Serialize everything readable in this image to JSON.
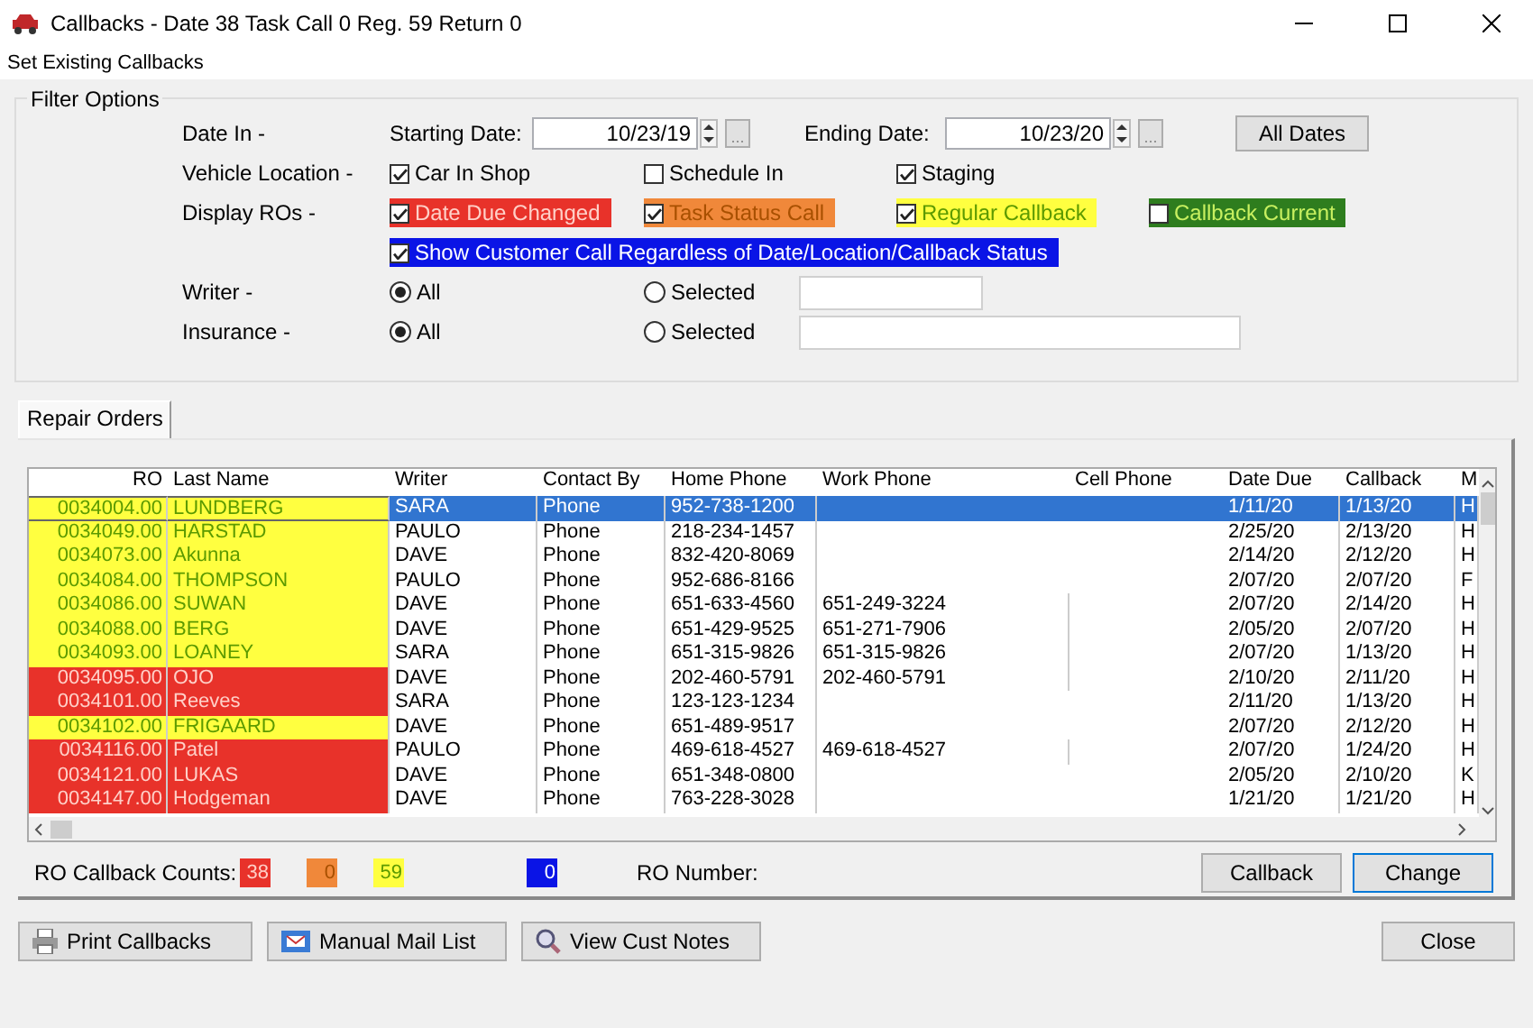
{
  "window": {
    "title": "Callbacks - Date 38 Task Call 0 Reg. 59 Return 0"
  },
  "menu": [
    "Set Existing Callbacks"
  ],
  "filter_options": {
    "title": "Filter Options",
    "date_in": {
      "label": "Date In -",
      "starting_label": "Starting Date:",
      "starting_value": "10/23/19",
      "ending_label": "Ending Date:",
      "ending_value": "10/23/20",
      "browse_button": "...",
      "all_dates_button": "All Dates"
    },
    "vehicle_location": {
      "label": "Vehicle Location -",
      "options": [
        {
          "label": "Car In Shop",
          "checked": true
        },
        {
          "label": "Schedule In",
          "checked": false
        },
        {
          "label": "Staging",
          "checked": true
        }
      ]
    },
    "display_ros": {
      "label": "Display ROs -",
      "options": [
        {
          "label": "Date Due Changed",
          "checked": true,
          "kind": "date_due",
          "color": "#e8322a"
        },
        {
          "label": "Task Status Call",
          "checked": true,
          "kind": "task",
          "color": "#f0883a"
        },
        {
          "label": "Regular Callback",
          "checked": true,
          "kind": "regular",
          "color": "#ffff40"
        },
        {
          "label": "Callback Current",
          "checked": false,
          "kind": "current",
          "color": "#2e7d1e"
        }
      ],
      "show_customer_call": {
        "label": "Show Customer Call Regardless of Date/Location/Callback Status",
        "checked": true,
        "kind": "show_all",
        "color": "#0a14e6"
      }
    },
    "writer": {
      "label": "Writer -",
      "options": [
        {
          "label": "All",
          "selected": true
        },
        {
          "label": "Selected",
          "selected": false
        }
      ]
    },
    "insurance": {
      "label": "Insurance -",
      "options": [
        {
          "label": "All",
          "selected": true
        },
        {
          "label": "Selected",
          "selected": false
        }
      ]
    }
  },
  "tabs": [
    {
      "label": "Repair Orders",
      "selected": true
    }
  ],
  "table": {
    "columns": [
      "RO",
      "Last Name",
      "Writer",
      "Contact By",
      "Home Phone",
      "Work Phone",
      "Cell Phone",
      "Date Due",
      "Callback",
      "M"
    ],
    "rows": [
      {
        "kind": "regular",
        "color": "#ffff40",
        "selected": true,
        "cells": [
          "0034004.00",
          "LUNDBERG",
          "SARA",
          "Phone",
          "952-738-1200",
          "",
          "",
          "1/11/20",
          "1/13/20",
          "H"
        ]
      },
      {
        "kind": "regular",
        "color": "#ffff40",
        "selected": false,
        "cells": [
          "0034049.00",
          "HARSTAD",
          "PAULO",
          "Phone",
          "218-234-1457",
          "",
          "",
          "2/25/20",
          "2/13/20",
          "H"
        ]
      },
      {
        "kind": "regular",
        "color": "#ffff40",
        "selected": false,
        "cells": [
          "0034073.00",
          "Akunna",
          "DAVE",
          "Phone",
          "832-420-8069",
          "",
          "",
          "2/14/20",
          "2/12/20",
          "H"
        ]
      },
      {
        "kind": "regular",
        "color": "#ffff40",
        "selected": false,
        "cells": [
          "0034084.00",
          "THOMPSON",
          "PAULO",
          "Phone",
          "952-686-8166",
          "",
          "",
          "2/07/20",
          "2/07/20",
          "F"
        ]
      },
      {
        "kind": "regular",
        "color": "#ffff40",
        "selected": false,
        "cells": [
          "0034086.00",
          "SUWAN",
          "DAVE",
          "Phone",
          "651-633-4560",
          "651-249-3224",
          "",
          "2/07/20",
          "2/14/20",
          "H"
        ]
      },
      {
        "kind": "regular",
        "color": "#ffff40",
        "selected": false,
        "cells": [
          "0034088.00",
          "BERG",
          "DAVE",
          "Phone",
          "651-429-9525",
          "651-271-7906",
          "",
          "2/05/20",
          "2/07/20",
          "H"
        ]
      },
      {
        "kind": "regular",
        "color": "#ffff40",
        "selected": false,
        "cells": [
          "0034093.00",
          "LOANEY",
          "SARA",
          "Phone",
          "651-315-9826",
          "651-315-9826",
          "",
          "2/07/20",
          "1/13/20",
          "H"
        ]
      },
      {
        "kind": "date_due",
        "color": "#e8322a",
        "selected": false,
        "cells": [
          "0034095.00",
          "OJO",
          "DAVE",
          "Phone",
          "202-460-5791",
          "202-460-5791",
          "",
          "2/10/20",
          "2/11/20",
          "H"
        ]
      },
      {
        "kind": "date_due",
        "color": "#e8322a",
        "selected": false,
        "cells": [
          "0034101.00",
          "Reeves",
          "SARA",
          "Phone",
          "123-123-1234",
          "",
          "",
          "2/11/20",
          "1/13/20",
          "H"
        ]
      },
      {
        "kind": "regular",
        "color": "#ffff40",
        "selected": false,
        "cells": [
          "0034102.00",
          "FRIGAARD",
          "DAVE",
          "Phone",
          "651-489-9517",
          "",
          "",
          "2/07/20",
          "2/12/20",
          "H"
        ]
      },
      {
        "kind": "date_due",
        "color": "#e8322a",
        "selected": false,
        "cells": [
          "0034116.00",
          "Patel",
          "PAULO",
          "Phone",
          "469-618-4527",
          "469-618-4527",
          "",
          "2/07/20",
          "1/24/20",
          "H"
        ]
      },
      {
        "kind": "date_due",
        "color": "#e8322a",
        "selected": false,
        "cells": [
          "0034121.00",
          "LUKAS",
          "DAVE",
          "Phone",
          "651-348-0800",
          "",
          "",
          "2/05/20",
          "2/10/20",
          "K"
        ]
      },
      {
        "kind": "date_due",
        "color": "#e8322a",
        "selected": false,
        "cells": [
          "0034147.00",
          "Hodgeman",
          "DAVE",
          "Phone",
          "763-228-3028",
          "",
          "",
          "1/21/20",
          "1/21/20",
          "H"
        ]
      }
    ]
  },
  "counts": {
    "label": "RO Callback Counts:",
    "items": [
      {
        "value": "38",
        "kind": "date_due",
        "color": "#e8322a"
      },
      {
        "value": "0",
        "kind": "task",
        "color": "#f0883a"
      },
      {
        "value": "59",
        "kind": "regular",
        "color": "#ffff40"
      },
      {
        "value": "0",
        "kind": "show_all",
        "color": "#0a14e6"
      }
    ],
    "ro_number_label": "RO Number:",
    "callback_button": "Callback",
    "change_button": "Change"
  },
  "footer": {
    "print_button": "Print Callbacks",
    "mail_button": "Manual Mail List",
    "notes_button": "View Cust Notes",
    "close_button": "Close"
  }
}
